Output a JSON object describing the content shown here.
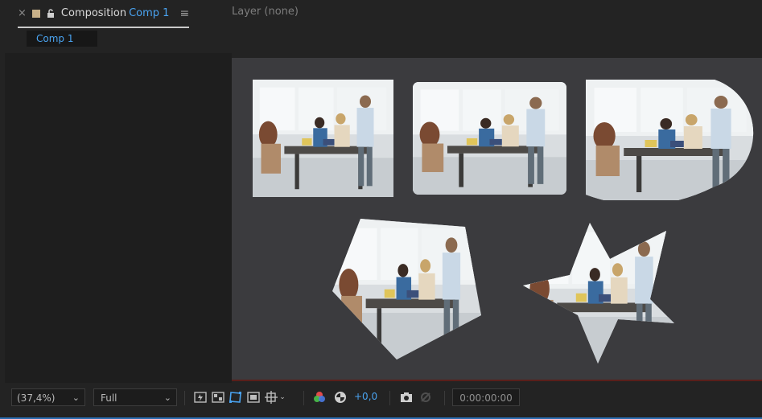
{
  "panel": {
    "close_glyph": "×",
    "tab_title": "Composition",
    "comp_name": "Comp 1",
    "menu_glyph": "≡",
    "layer_tab": "Layer  (none)",
    "breadcrumb": "Comp 1"
  },
  "footer": {
    "zoom": "(37,4%)",
    "resolution": "Full",
    "exposure": "+0,0",
    "timecode": "0:00:00:00"
  },
  "colors": {
    "accent": "#4aa3f0",
    "label_swatch": "#c9b189"
  }
}
